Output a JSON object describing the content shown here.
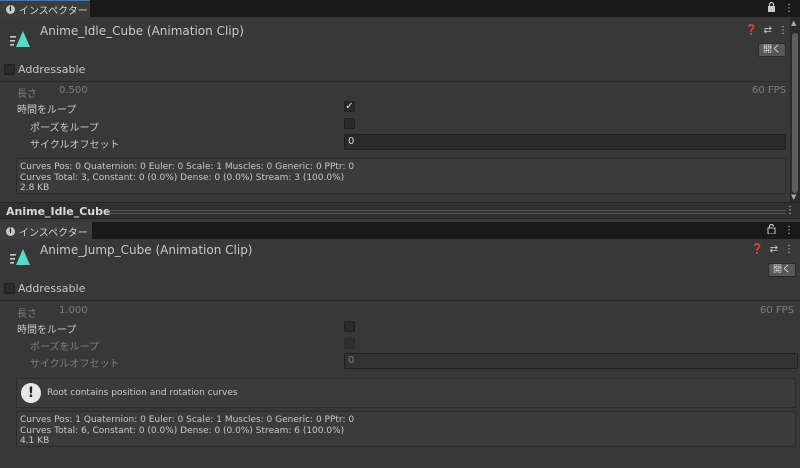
{
  "panel1": {
    "tab_label": "インスペクター",
    "clip_title": "Anime_Idle_Cube (Animation Clip)",
    "open_label": "開く",
    "addressable": "Addressable",
    "length_label": "長さ",
    "length_value": "0.500",
    "fps": "60 FPS",
    "loop_time": "時間をループ",
    "loop_pose": "ポーズをループ",
    "cycle_offset": "サイクルオフセット",
    "cycle_offset_value": "0",
    "stats": [
      "Curves Pos: 0 Quaternion: 0 Euler: 0 Scale: 1 Muscles: 0 Generic: 0 PPtr: 0",
      "Curves Total: 3, Constant: 0 (0.0%) Dense: 0 (0.0%) Stream: 3 (100.0%)",
      "2.8 KB"
    ]
  },
  "preview_bar": {
    "label": "Anime_Idle_Cube"
  },
  "panel2": {
    "tab_label": "インスペクター",
    "clip_title": "Anime_Jump_Cube (Animation Clip)",
    "open_label": "開く",
    "addressable": "Addressable",
    "length_label": "長さ",
    "length_value": "1.000",
    "fps": "60 FPS",
    "loop_time": "時間をループ",
    "loop_pose": "ポーズをループ",
    "cycle_offset": "サイクルオフセット",
    "cycle_offset_value": "0",
    "warning": "Root contains position and rotation curves",
    "stats": [
      "Curves Pos: 1 Quaternion: 0 Euler: 0 Scale: 1 Muscles: 0 Generic: 0 PPtr: 0",
      "Curves Total: 6, Constant: 0 (0.0%) Dense: 0 (0.0%) Stream: 6 (100.0%)",
      "4.1 KB"
    ]
  },
  "icons": {
    "lock": "lock-icon",
    "menu": "kebab-menu-icon",
    "help": "help-icon",
    "preset": "preset-icon",
    "clip": "animation-clip-icon",
    "warning": "warning-icon"
  },
  "colors": {
    "accent_tab": "#3a79bb",
    "clip_icon": "#5ad8c9"
  }
}
